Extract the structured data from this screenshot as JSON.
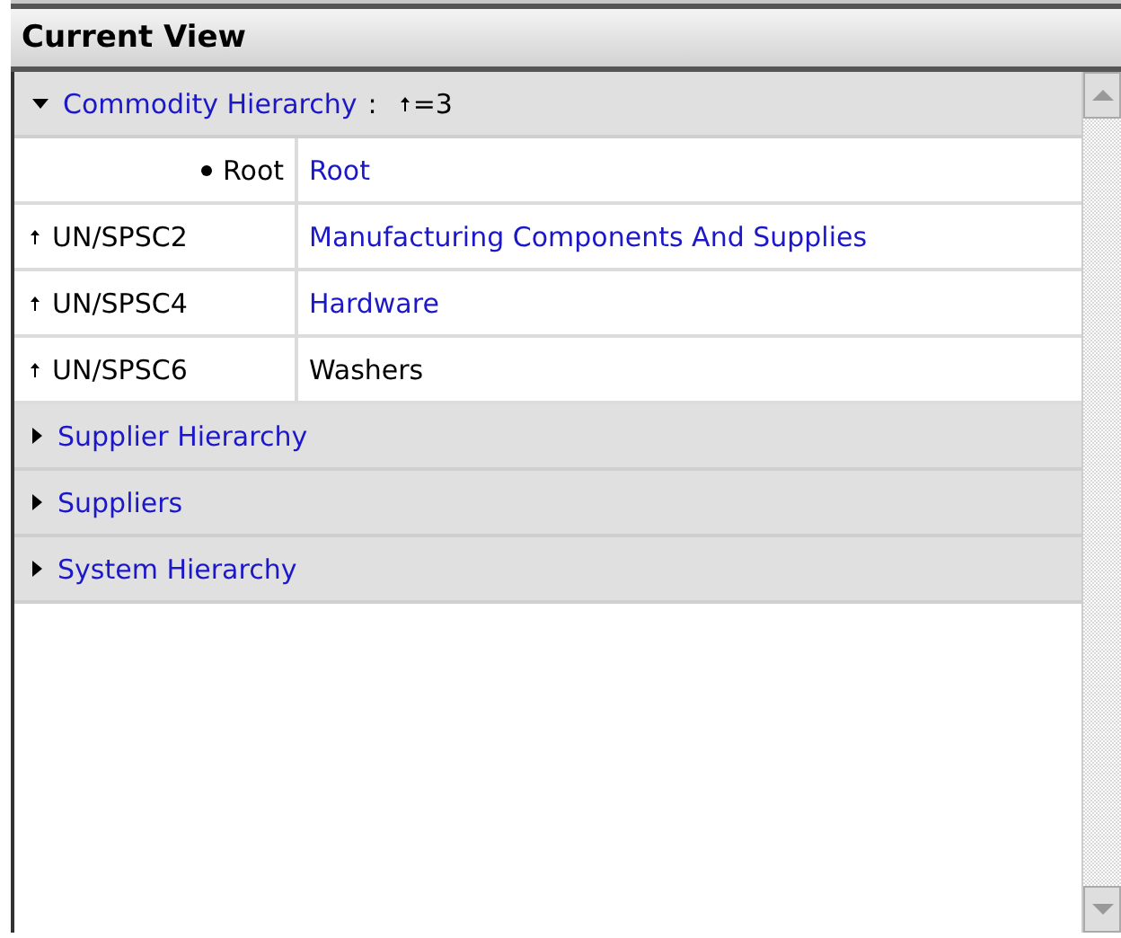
{
  "panel": {
    "title": "Current View"
  },
  "sections": [
    {
      "label": "Commodity Hierarchy",
      "expanded": true,
      "separator": ":",
      "filter": "=3",
      "rows": [
        {
          "kind": "bullet",
          "level": "Root",
          "value": "Root",
          "link": true
        },
        {
          "kind": "arrow",
          "level": "UN/SPSC2",
          "value": "Manufacturing Components And Supplies",
          "link": true
        },
        {
          "kind": "arrow",
          "level": "UN/SPSC4",
          "value": "Hardware",
          "link": true
        },
        {
          "kind": "arrow",
          "level": "UN/SPSC6",
          "value": "Washers",
          "link": false
        }
      ]
    },
    {
      "label": "Supplier Hierarchy",
      "expanded": false
    },
    {
      "label": "Suppliers",
      "expanded": false
    },
    {
      "label": "System Hierarchy",
      "expanded": false
    }
  ]
}
